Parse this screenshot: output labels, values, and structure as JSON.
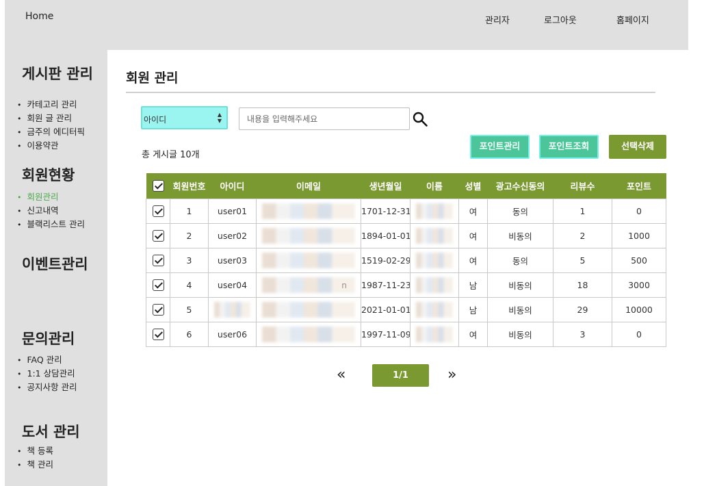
{
  "header": {
    "home": "Home",
    "nav": [
      "관리자",
      "로그아웃",
      "홈페이지"
    ]
  },
  "sidebar": {
    "sections": [
      {
        "title": "게시판 관리",
        "items": [
          "카테고리 관리",
          "회원 글 관리",
          "금주의 에디터픽",
          "이용약관"
        ]
      },
      {
        "title": "회원현황",
        "items": [
          "회원관리",
          "신고내역",
          "블랙리스트 관리"
        ],
        "active": "회원관리"
      },
      {
        "title": "이벤트관리",
        "items": []
      },
      {
        "title": "문의관리",
        "items": [
          "FAQ 관리",
          "1:1 상담관리",
          "공지사항 관리"
        ]
      },
      {
        "title": "도서 관리",
        "items": [
          "책 등록",
          "책 관리"
        ]
      }
    ]
  },
  "main": {
    "title": "회원 관리",
    "search": {
      "select_value": "아이디",
      "placeholder": "내용을 입력해주세요"
    },
    "total": "총 게시글 10개",
    "buttons": {
      "point_manage": "포인트관리",
      "point_view": "포인트조회",
      "delete_selected": "선택삭제"
    },
    "table": {
      "columns": [
        "회원번호",
        "아이디",
        "이메일",
        "생년월일",
        "이름",
        "성별",
        "광고수신동의",
        "리뷰수",
        "포인트"
      ],
      "rows": [
        {
          "no": "1",
          "id": "user01",
          "email": "",
          "birth": "1701-12-31",
          "name": "",
          "gender": "여",
          "ad": "동의",
          "reviews": "1",
          "point": "0"
        },
        {
          "no": "2",
          "id": "user02",
          "email": "",
          "birth": "1894-01-01",
          "name": "",
          "gender": "여",
          "ad": "비동의",
          "reviews": "2",
          "point": "1000"
        },
        {
          "no": "3",
          "id": "user03",
          "email": "",
          "birth": "1519-02-29",
          "name": "",
          "gender": "여",
          "ad": "동의",
          "reviews": "5",
          "point": "500"
        },
        {
          "no": "4",
          "id": "user04",
          "email": "n",
          "birth": "1987-11-23",
          "name": "",
          "gender": "남",
          "ad": "비동의",
          "reviews": "18",
          "point": "3000"
        },
        {
          "no": "5",
          "id": "",
          "email": "",
          "birth": "2021-01-01",
          "name": "",
          "gender": "남",
          "ad": "비동의",
          "reviews": "29",
          "point": "10000"
        },
        {
          "no": "6",
          "id": "user06",
          "email": "",
          "birth": "1997-11-09",
          "name": "",
          "gender": "여",
          "ad": "비동의",
          "reviews": "3",
          "point": "0"
        }
      ]
    },
    "pagination": {
      "prev": "«",
      "current": "1/1",
      "next": "»"
    }
  }
}
